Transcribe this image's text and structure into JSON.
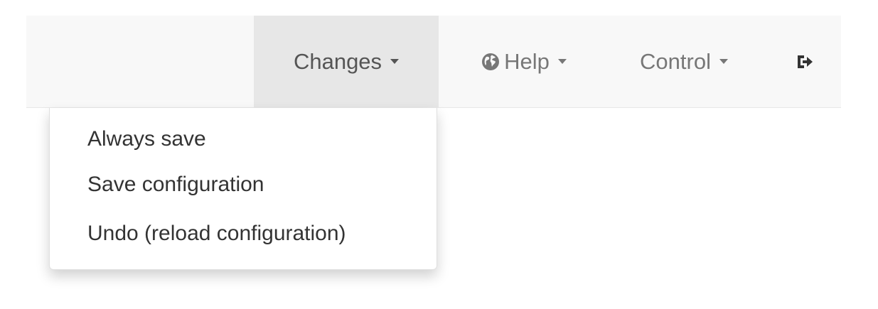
{
  "navbar": {
    "changes_label": "Changes",
    "help_label": "Help",
    "control_label": "Control",
    "help_icon": "globe-icon",
    "logout_icon": "sign-out-icon"
  },
  "changes_menu": {
    "items": [
      {
        "label": "Always save"
      },
      {
        "label": "Save configuration"
      },
      {
        "label": "Undo (reload configuration)"
      }
    ]
  },
  "colors": {
    "navbar_bg": "#f8f8f8",
    "active_item_bg": "#e7e7e7",
    "nav_text": "#777777",
    "menu_text": "#333333"
  }
}
